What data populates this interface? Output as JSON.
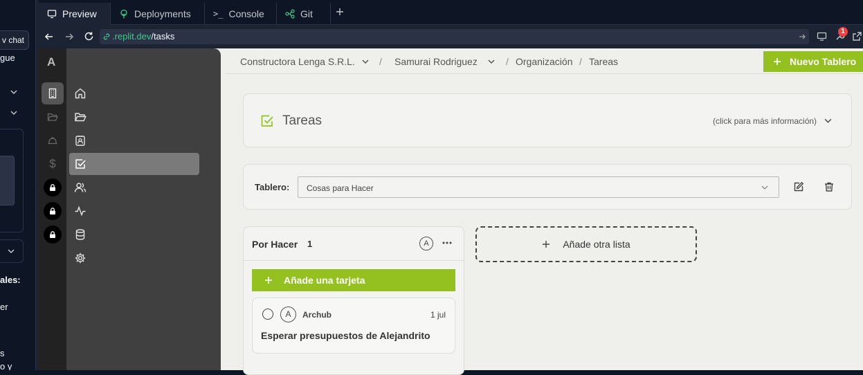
{
  "left_panel": {
    "new_chat_label": "v chat",
    "text_1": "gue",
    "text_2": "ales:",
    "text_3": "er",
    "text_4": "s",
    "text_5": "o y"
  },
  "tabs": [
    {
      "label": "Preview",
      "icon": "monitor-icon"
    },
    {
      "label": "Deployments",
      "icon": "deploy-icon"
    },
    {
      "label": "Console",
      "icon": "terminal-icon"
    },
    {
      "label": "Git",
      "icon": "git-icon"
    }
  ],
  "url": {
    "domain": ".replit.dev",
    "path": "/tasks"
  },
  "notification_count": "1",
  "app": {
    "logo_letter": "A",
    "breadcrumb": {
      "company": "Constructora Lenga S.R.L.",
      "user": "Samurai Rodriguez",
      "section": "Organización",
      "page": "Tareas",
      "separator": "/"
    },
    "new_board_button": "Nuevo Tablero",
    "header": {
      "title": "Tareas",
      "info_hint": "(click para más información)"
    },
    "board": {
      "label": "Tablero:",
      "selected": "Cosas para Hacer"
    },
    "list": {
      "title": "Por Hacer",
      "count": "1",
      "avatar": "A",
      "add_card_label": "Añade una tarjeta"
    },
    "card": {
      "avatar": "A",
      "author": "Archub",
      "date": "1 jul",
      "title": "Esperar presupuestos de Alejandrito"
    },
    "add_list_label": "Añade otra lista"
  },
  "colors": {
    "accent": "#94c11f",
    "replit_bg": "#0e1525",
    "app_bg": "#efefec"
  }
}
